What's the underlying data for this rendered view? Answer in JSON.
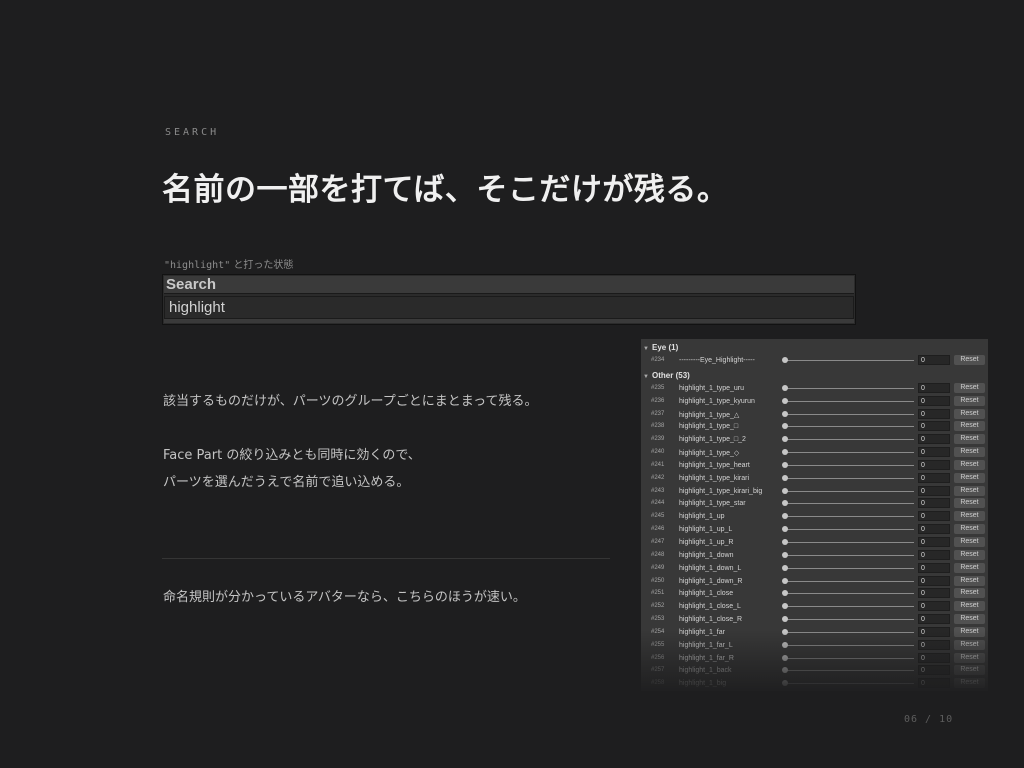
{
  "section_label": "SEARCH",
  "headline": "名前の一部を打てば、そこだけが残る。",
  "caption": {
    "query": "\"highlight\"",
    "suffix": " と打った状態"
  },
  "search": {
    "title": "Search",
    "value": "highlight"
  },
  "body": {
    "p1": "該当するものだけが、パーツのグループごとにまとまって残る。",
    "p2a": "Face Part の絞り込みとも同時に効くので、",
    "p2b": "パーツを選んだうえで名前で追い込める。",
    "p3": "命名規則が分かっているアバターなら、こちらのほうが速い。"
  },
  "page_number": "06 / 10",
  "inspector": {
    "reset_label": "Reset",
    "groups": [
      {
        "name": "Eye",
        "count": "(1)",
        "rows": [
          {
            "num": "#234",
            "name": "---------Eye_Highlight-----",
            "value": "0"
          }
        ]
      },
      {
        "name": "Other",
        "count": "(53)",
        "rows": [
          {
            "num": "#235",
            "name": "highlight_1_type_uru",
            "value": "0"
          },
          {
            "num": "#236",
            "name": "highlight_1_type_kyurun",
            "value": "0"
          },
          {
            "num": "#237",
            "name": "highlight_1_type_△",
            "value": "0"
          },
          {
            "num": "#238",
            "name": "highlight_1_type_□",
            "value": "0"
          },
          {
            "num": "#239",
            "name": "highlight_1_type_□_2",
            "value": "0"
          },
          {
            "num": "#240",
            "name": "highlight_1_type_◇",
            "value": "0"
          },
          {
            "num": "#241",
            "name": "highlight_1_type_heart",
            "value": "0"
          },
          {
            "num": "#242",
            "name": "highlight_1_type_kirari",
            "value": "0"
          },
          {
            "num": "#243",
            "name": "highlight_1_type_kirari_big",
            "value": "0"
          },
          {
            "num": "#244",
            "name": "highlight_1_type_star",
            "value": "0"
          },
          {
            "num": "#245",
            "name": "highlight_1_up",
            "value": "0"
          },
          {
            "num": "#246",
            "name": "highlight_1_up_L",
            "value": "0"
          },
          {
            "num": "#247",
            "name": "highlight_1_up_R",
            "value": "0"
          },
          {
            "num": "#248",
            "name": "highlight_1_down",
            "value": "0"
          },
          {
            "num": "#249",
            "name": "highlight_1_down_L",
            "value": "0"
          },
          {
            "num": "#250",
            "name": "highlight_1_down_R",
            "value": "0"
          },
          {
            "num": "#251",
            "name": "highlight_1_close",
            "value": "0"
          },
          {
            "num": "#252",
            "name": "highlight_1_close_L",
            "value": "0"
          },
          {
            "num": "#253",
            "name": "highlight_1_close_R",
            "value": "0"
          },
          {
            "num": "#254",
            "name": "highlight_1_far",
            "value": "0"
          },
          {
            "num": "#255",
            "name": "highlight_1_far_L",
            "value": "0"
          },
          {
            "num": "#256",
            "name": "highlight_1_far_R",
            "value": "0"
          },
          {
            "num": "#257",
            "name": "highlight_1_back",
            "value": "0"
          },
          {
            "num": "#258",
            "name": "highlight_1_big",
            "value": "0"
          }
        ]
      }
    ]
  }
}
